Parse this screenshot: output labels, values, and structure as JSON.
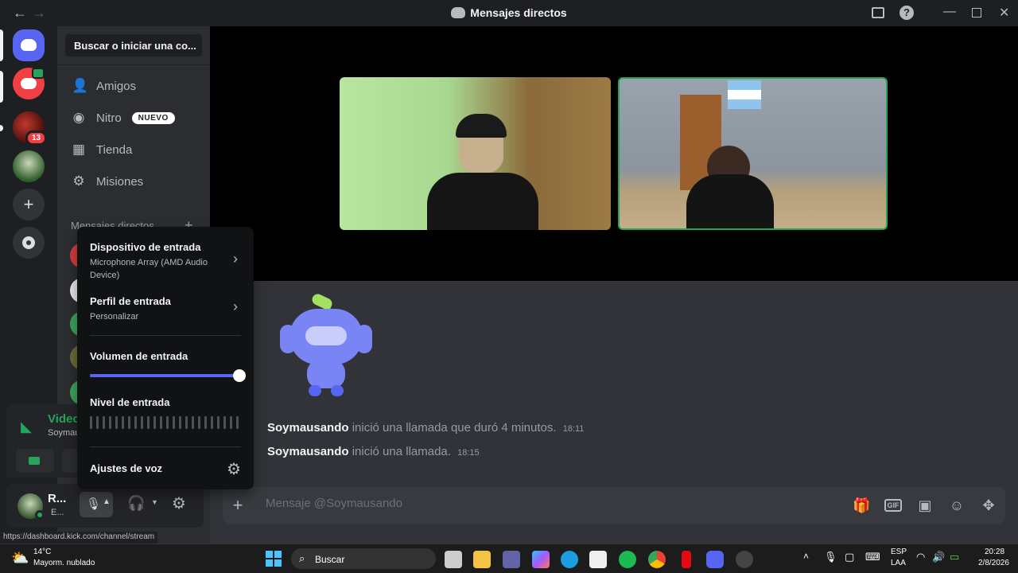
{
  "titlebar": {
    "title": "Mensajes directos"
  },
  "servers": {
    "badge_count": "13"
  },
  "sidebar": {
    "search_label": "Buscar o iniciar una co...",
    "items": [
      {
        "label": "Amigos",
        "icon": "friends-icon"
      },
      {
        "label": "Nitro",
        "icon": "nitro-icon",
        "badge": "NUEVO"
      },
      {
        "label": "Tienda",
        "icon": "shop-icon"
      },
      {
        "label": "Misiones",
        "icon": "quests-icon"
      }
    ],
    "dm_header": "Mensajes directos"
  },
  "voice_panel": {
    "status": "Video",
    "subtitle": "Soymau"
  },
  "user_panel": {
    "name": "R...",
    "status": "E..."
  },
  "popup": {
    "input_device_title": "Dispositivo de entrada",
    "input_device_value": "Microphone Array (AMD Audio Device)",
    "input_profile_title": "Perfil de entrada",
    "input_profile_value": "Personalizar",
    "input_volume_title": "Volumen de entrada",
    "input_volume_level": 1.0,
    "input_level_title": "Nivel de entrada",
    "voice_settings": "Ajustes de voz"
  },
  "messages": [
    {
      "author": "Soymausando",
      "text": "inició una llamada que duró 4 minutos.",
      "time": "18:11"
    },
    {
      "author": "Soymausando",
      "text": "inició una llamada.",
      "time": "18:15"
    }
  ],
  "composer": {
    "placeholder": "Mensaje @Soymausando"
  },
  "status_url": "https://dashboard.kick.com/channel/stream",
  "taskbar": {
    "weather_temp": "14°C",
    "weather_desc": "Mayorm. nublado",
    "search_label": "Buscar",
    "lang": "ESP",
    "lang_sub": "LAA",
    "time": "20:28",
    "date": "2/8/2026"
  }
}
